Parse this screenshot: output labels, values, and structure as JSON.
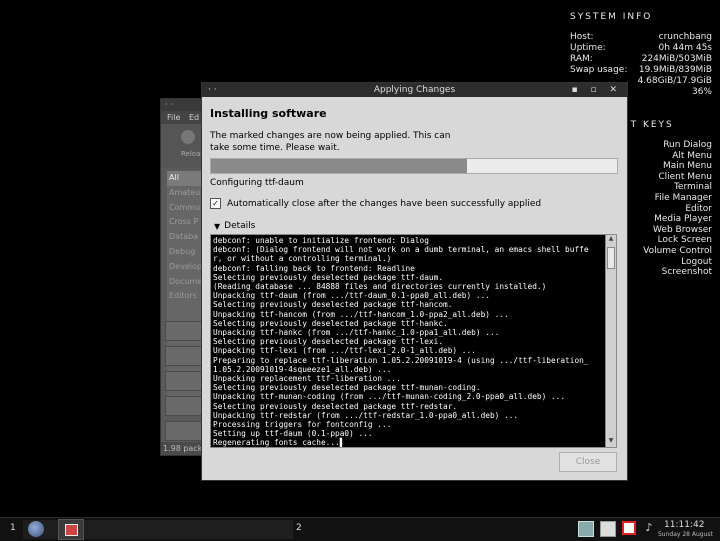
{
  "conky": {
    "header": "SYSTEM INFO",
    "rows": [
      {
        "label": "Host:",
        "value": "crunchbang"
      },
      {
        "label": "Uptime:",
        "value": "0h 44m 45s"
      },
      {
        "label": "RAM:",
        "value": "224MiB/503MiB"
      },
      {
        "label": "Swap usage:",
        "value": "19.9MiB/839MiB"
      },
      {
        "label": "",
        "value": "4.68GiB/17.9GiB"
      },
      {
        "label": "",
        "value": "36%"
      }
    ],
    "shortcuts_header_partial": "UT KEYS",
    "shortcuts": [
      "Run Dialog",
      "Alt Menu",
      "Main Menu",
      "Client Menu",
      "Terminal",
      "File Manager",
      "Editor",
      "Media Player",
      "Web Browser",
      "Lock Screen",
      "Volume Control",
      "Logout",
      "Screenshot"
    ]
  },
  "bg_window": {
    "title_partial": "· ·",
    "menu": [
      "File",
      "Ed"
    ],
    "toolbar_label": "Reload",
    "filters": [
      "All",
      "Amateur",
      "Commu",
      "Cross P",
      "Databa",
      "Debug",
      "Develop",
      "Docume",
      "Editors"
    ],
    "status": "1.98 pack"
  },
  "dialog": {
    "title": "Applying Changes",
    "title_left": "· ·",
    "title_right": "▪ ▫ ✕",
    "heading": "Installing software",
    "description": "The marked changes are now being applied. This can take some time. Please wait.",
    "progress_fraction": 0.63,
    "status": "Configuring ttf-daum",
    "auto_close_label": "Automatically close after the changes have been successfully applied",
    "auto_close_checked": true,
    "details_label": "Details",
    "close_label": "Close",
    "terminal_lines": [
      "debconf: unable to initialize frontend: Dialog",
      "debconf: (Dialog frontend will not work on a dumb terminal, an emacs shell buffe",
      "r, or without a controlling terminal.)",
      "debconf: falling back to frontend: Readline",
      "Selecting previously deselected package ttf-daum.",
      "(Reading database ... 84888 files and directories currently installed.)",
      "Unpacking ttf-daum (from .../ttf-daum_0.1-ppa0_all.deb) ...",
      "Selecting previously deselected package ttf-hancom.",
      "Unpacking ttf-hancom (from .../ttf-hancom_1.0-ppa2_all.deb) ...",
      "Selecting previously deselected package ttf-hankc.",
      "Unpacking ttf-hankc (from .../ttf-hankc_1.0-ppa1_all.deb) ...",
      "Selecting previously deselected package ttf-lexi.",
      "Unpacking ttf-lexi (from .../ttf-lexi_2.0-1_all.deb) ...",
      "Preparing to replace ttf-liberation 1.05.2.20091019-4 (using .../ttf-liberation_",
      "1.05.2.20091019-4squeeze1_all.deb) ...",
      "Unpacking replacement ttf-liberation ...",
      "Selecting previously deselected package ttf-munan-coding.",
      "Unpacking ttf-munan-coding (from .../ttf-munan-coding_2.0-ppa0_all.deb) ...",
      "Selecting previously deselected package ttf-redstar.",
      "Unpacking ttf-redstar (from .../ttf-redstar_1.0-ppa0_all.deb) ...",
      "Processing triggers for fontconfig ...",
      "Setting up ttf-daum (0.1-ppa0) ...",
      "Regenerating fonts cache...▌"
    ]
  },
  "taskbar": {
    "workspace1": "1",
    "workspace2": "2",
    "clock_time": "11:11:42",
    "clock_date": "Sunday 28 August",
    "volume_icon": "♪"
  }
}
